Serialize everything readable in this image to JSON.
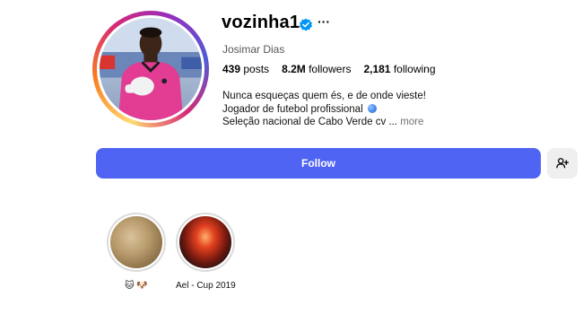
{
  "profile": {
    "username": "vozinha1",
    "full_name": "Josimar Dias",
    "verified_icon": "verified-badge-icon",
    "options_icon": "more-options-icon",
    "more_label": "···"
  },
  "stats": {
    "posts_count": "439",
    "posts_label": "posts",
    "followers_count": "8.2M",
    "followers_label": "followers",
    "following_count": "2,181",
    "following_label": "following"
  },
  "bio": {
    "line1": "Nunca esqueças quem és, e de onde vieste!",
    "line2": "Jogador de futebol profissional",
    "line3": "Seleção nacional de Cabo Verde cv ...",
    "more_label": "more"
  },
  "actions": {
    "follow_label": "Follow",
    "suggest_icon": "add-person-icon"
  },
  "highlights": [
    {
      "label": "🐱 🐶"
    },
    {
      "label": "Ael - Cup 2019"
    }
  ],
  "colors": {
    "follow_button": "#4f64f3",
    "verified": "#0095f6",
    "secondary_text": "#737373"
  }
}
